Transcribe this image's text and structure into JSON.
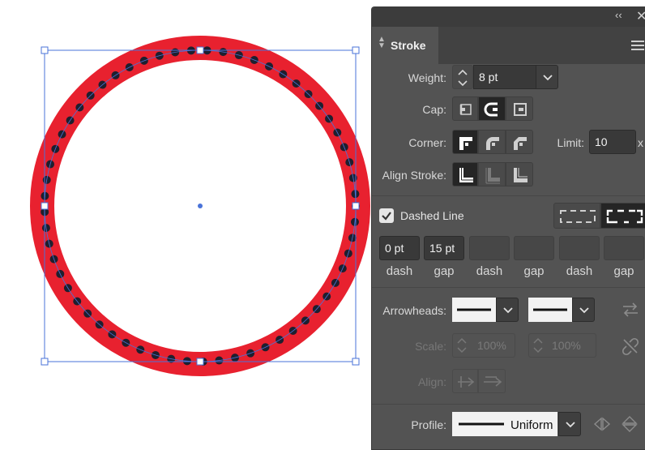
{
  "panel": {
    "tab_title": "Stroke",
    "weight": {
      "label": "Weight:",
      "value": "8 pt"
    },
    "cap": {
      "label": "Cap:",
      "selected": "round"
    },
    "corner": {
      "label": "Corner:",
      "selected": "miter",
      "limit_label": "Limit:",
      "limit_value": "10",
      "limit_suffix": "x"
    },
    "align_stroke": {
      "label": "Align Stroke:",
      "selected": "center"
    },
    "dashed_line": {
      "label": "Dashed Line",
      "checked": true,
      "mode_selected": "align-to-corners"
    },
    "dash_gap": [
      {
        "value": "0 pt",
        "label": "dash"
      },
      {
        "value": "15 pt",
        "label": "gap"
      },
      {
        "value": "",
        "label": "dash"
      },
      {
        "value": "",
        "label": "gap"
      },
      {
        "value": "",
        "label": "dash"
      },
      {
        "value": "",
        "label": "gap"
      }
    ],
    "arrowheads": {
      "label": "Arrowheads:"
    },
    "scale": {
      "label": "Scale:",
      "start": "100%",
      "end": "100%"
    },
    "align": {
      "label": "Align:"
    },
    "profile": {
      "label": "Profile:",
      "value": "Uniform"
    }
  },
  "colors": {
    "ring": "#e8212f",
    "dots": "#1f1f2e",
    "selection": "#4a73d9",
    "panel_bg": "#535353"
  },
  "icons": {
    "collapse": "double-chevron-left-icon",
    "close": "close-icon",
    "menu": "hamburger-menu-icon",
    "swap": "swap-arrows-icon",
    "link": "unlink-icon"
  }
}
